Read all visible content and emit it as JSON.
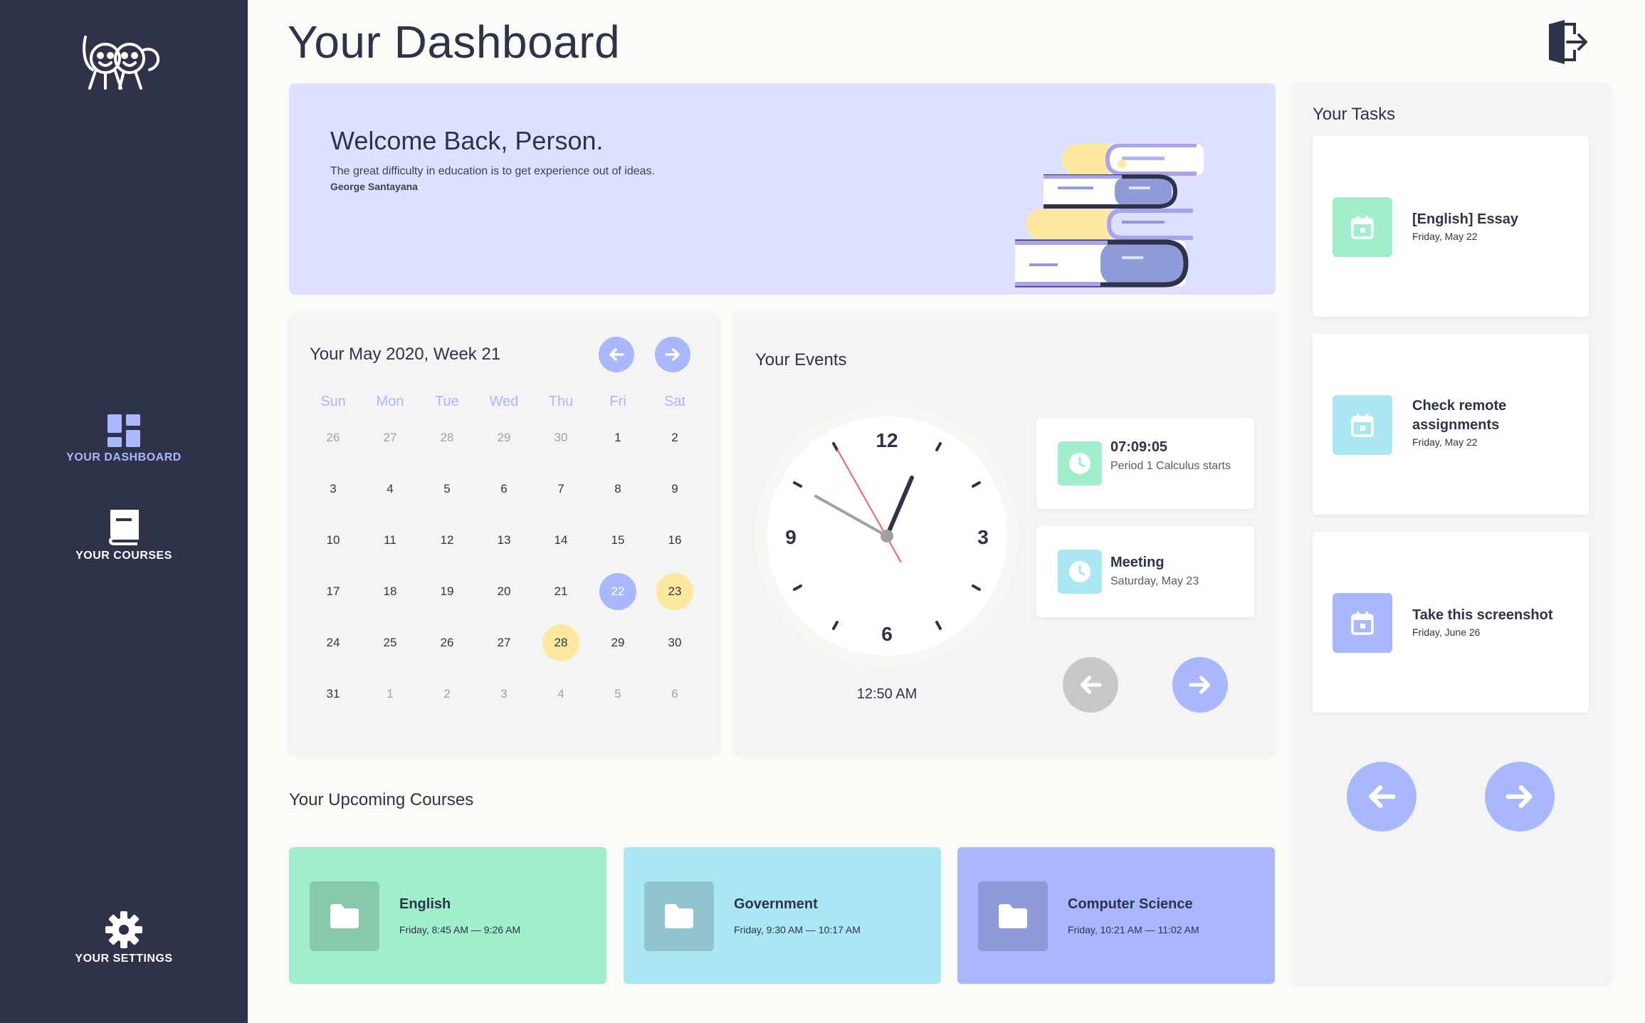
{
  "nav": {
    "dashboard": "YOUR DASHBOARD",
    "courses": "YOUR COURSES",
    "settings": "YOUR SETTINGS"
  },
  "header": {
    "title": "Your Dashboard"
  },
  "welcome": {
    "heading": "Welcome Back, Person.",
    "quote": "The great difficulty in education is to get experience out of ideas.",
    "author": "George Santayana"
  },
  "calendar": {
    "title": "Your May 2020, Week 21",
    "weekdays": [
      "Sun",
      "Mon",
      "Tue",
      "Wed",
      "Thu",
      "Fri",
      "Sat"
    ],
    "weeks": [
      [
        {
          "d": "26",
          "muted": true
        },
        {
          "d": "27",
          "muted": true
        },
        {
          "d": "28",
          "muted": true
        },
        {
          "d": "29",
          "muted": true
        },
        {
          "d": "30",
          "muted": true
        },
        {
          "d": "1"
        },
        {
          "d": "2"
        }
      ],
      [
        {
          "d": "3"
        },
        {
          "d": "4"
        },
        {
          "d": "5"
        },
        {
          "d": "6"
        },
        {
          "d": "7"
        },
        {
          "d": "8"
        },
        {
          "d": "9"
        }
      ],
      [
        {
          "d": "10"
        },
        {
          "d": "11"
        },
        {
          "d": "12"
        },
        {
          "d": "13"
        },
        {
          "d": "14"
        },
        {
          "d": "15"
        },
        {
          "d": "16"
        }
      ],
      [
        {
          "d": "17"
        },
        {
          "d": "18"
        },
        {
          "d": "19"
        },
        {
          "d": "20"
        },
        {
          "d": "21"
        },
        {
          "d": "22",
          "today": true
        },
        {
          "d": "23",
          "event": true
        }
      ],
      [
        {
          "d": "24"
        },
        {
          "d": "25"
        },
        {
          "d": "26"
        },
        {
          "d": "27"
        },
        {
          "d": "28",
          "event": true
        },
        {
          "d": "29"
        },
        {
          "d": "30"
        }
      ],
      [
        {
          "d": "31"
        },
        {
          "d": "1",
          "muted": true
        },
        {
          "d": "2",
          "muted": true
        },
        {
          "d": "3",
          "muted": true
        },
        {
          "d": "4",
          "muted": true
        },
        {
          "d": "5",
          "muted": true
        },
        {
          "d": "6",
          "muted": true
        }
      ]
    ]
  },
  "events": {
    "title": "Your Events",
    "clock_time": "12:50 AM",
    "clock_numerals": {
      "n12": "12",
      "n3": "3",
      "n6": "6",
      "n9": "9"
    },
    "items": [
      {
        "title": "07:09:05",
        "desc": "Period 1 Calculus starts",
        "icon": "clock-icon",
        "color": "#a0eecb"
      },
      {
        "title": "Meeting",
        "desc": "Saturday, May 23",
        "icon": "clock-icon",
        "color": "#abe6f3"
      }
    ]
  },
  "courses": {
    "title": "Your Upcoming Courses",
    "items": [
      {
        "name": "English",
        "time": "Friday, 8:45 AM — 9:26 AM",
        "color": "#a0eecb",
        "icon_bg": "#88c9ac",
        "icon": "folder-icon"
      },
      {
        "name": "Government",
        "time": "Friday, 9:30 AM — 10:17 AM",
        "color": "#abe6f3",
        "icon_bg": "#92c4cf",
        "icon": "folder-icon"
      },
      {
        "name": "Computer Science",
        "time": "Friday, 10:21 AM — 11:02 AM",
        "color": "#a9b7ff",
        "icon_bg": "#8f9bd9",
        "icon": "folder-icon"
      }
    ]
  },
  "tasks": {
    "title": "Your Tasks",
    "items": [
      {
        "name": "[English] Essay",
        "date": "Friday, May 22",
        "color": "#a0eecb",
        "icon": "calendar-icon"
      },
      {
        "name": "Check remote assignments",
        "date": "Friday, May 22",
        "color": "#abe6f3",
        "icon": "calendar-icon"
      },
      {
        "name": "Take this screenshot",
        "date": "Friday, June 26",
        "color": "#a9b7ff",
        "icon": "calendar-icon"
      }
    ]
  },
  "colors": {
    "sidebar": "#2f3349",
    "accent": "#a9b7ff",
    "banner": "#dde0ff",
    "highlight_yellow": "#fde8a0"
  }
}
